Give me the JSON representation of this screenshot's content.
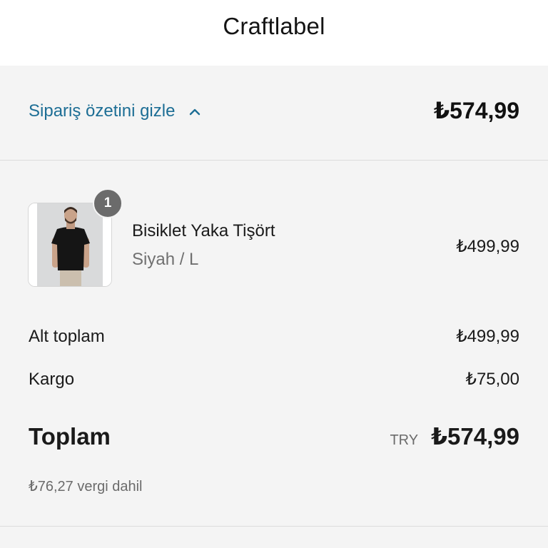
{
  "header": {
    "brand": "Craftlabel"
  },
  "summary_toggle": {
    "label": "Sipariş özetini gizle",
    "total": "₺574,99",
    "icon": "chevron-up-icon",
    "link_color": "#1d6e95"
  },
  "line_items": [
    {
      "name": "Bisiklet Yaka Tişört",
      "variant": "Siyah / L",
      "quantity": "1",
      "price": "₺499,99",
      "image": "product-photo-black-tshirt"
    }
  ],
  "totals": {
    "subtotal_label": "Alt toplam",
    "subtotal_value": "₺499,99",
    "shipping_label": "Kargo",
    "shipping_value": "₺75,00",
    "total_label": "Toplam",
    "currency_code": "TRY",
    "total_value": "₺574,99",
    "tax_note": "₺76,27 vergi dahil"
  }
}
